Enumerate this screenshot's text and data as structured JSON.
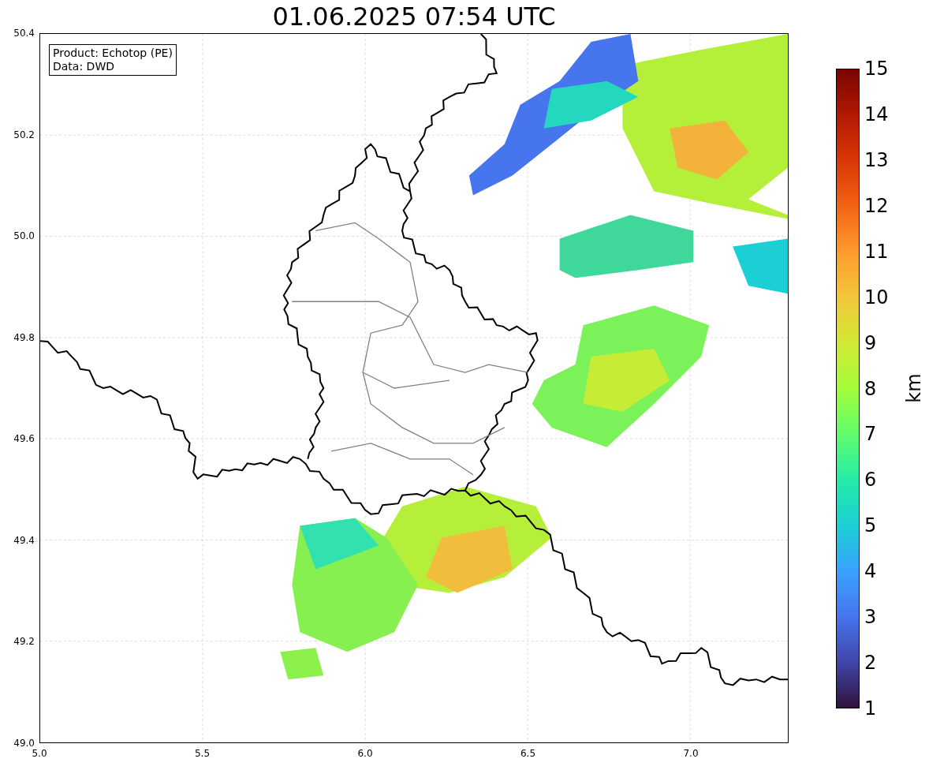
{
  "title": "01.06.2025 07:54 UTC",
  "info_box": {
    "lines": [
      "Product: Echotop (PE)",
      "Data: DWD"
    ]
  },
  "map": {
    "y_ticks": [
      "50.4",
      "50.2",
      "50.0",
      "49.8",
      "49.6",
      "49.4",
      "49.2",
      "49.0"
    ],
    "x_ticks": [
      "5.0",
      "5.5",
      "6.0",
      "6.5",
      "7.0"
    ]
  },
  "colorbar": {
    "ticks": [
      "15",
      "14",
      "13",
      "12",
      "11",
      "10",
      "9",
      "8",
      "7",
      "6",
      "5",
      "4",
      "3",
      "2",
      "1"
    ],
    "label": "km"
  }
}
